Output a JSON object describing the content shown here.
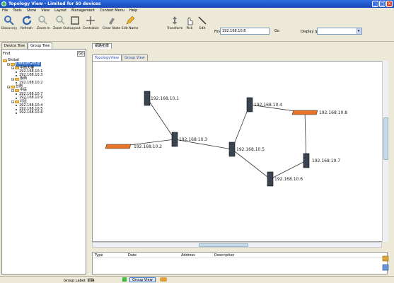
{
  "window": {
    "title": "Topology View - Limited for 50 devices"
  },
  "menu": [
    "File",
    "Tools",
    "Show",
    "View",
    "Layout",
    "Management",
    "Context Menu",
    "Help"
  ],
  "toolbar": {
    "buttons": [
      "Discovery",
      "Refresh",
      "Zoom In",
      "Zoom Out",
      "Layout",
      "Centralize",
      "Clear State",
      "Edit Name",
      "Transform",
      "Pick",
      "Edit"
    ],
    "find_label": "Find",
    "find_value": "192.168.10.8",
    "go_label": "Go",
    "display_label": "Display Ip"
  },
  "left": {
    "tabs": [
      "Device Tree",
      "Group Tree"
    ],
    "find_label": "Find",
    "find_button": "Go",
    "tree": [
      {
        "label": "Global",
        "level": 0,
        "type": "folder"
      },
      {
        "label": "DefaultGroup",
        "level": 1,
        "type": "folder",
        "selected": true
      },
      {
        "label": "中西大樓",
        "level": 2,
        "type": "folder"
      },
      {
        "label": "192.168.10.1",
        "level": 3,
        "type": "ip"
      },
      {
        "label": "192.168.10.3",
        "level": 3,
        "type": "ip"
      },
      {
        "label": "板西",
        "level": 2,
        "type": "folder"
      },
      {
        "label": "192.168.10.2",
        "level": 3,
        "type": "ip"
      },
      {
        "label": "台南",
        "level": 1,
        "type": "folder"
      },
      {
        "label": "中區",
        "level": 2,
        "type": "folder"
      },
      {
        "label": "192.168.10.7",
        "level": 3,
        "type": "ip"
      },
      {
        "label": "192.168.10.9",
        "level": 3,
        "type": "ip"
      },
      {
        "label": "北區",
        "level": 2,
        "type": "folder"
      },
      {
        "label": "192.168.10.4",
        "level": 3,
        "type": "ip"
      },
      {
        "label": "192.168.10.5",
        "level": 3,
        "type": "ip"
      },
      {
        "label": "192.168.10.6",
        "level": 3,
        "type": "ip"
      }
    ]
  },
  "right": {
    "doc_tab": "網路拓撲",
    "view_tabs": [
      "TopologyView",
      "Group View"
    ]
  },
  "topology": {
    "nodes": [
      {
        "label": "192.168.10.1",
        "kind": "tower"
      },
      {
        "label": "192.168.10.2",
        "kind": "flat"
      },
      {
        "label": "192.168.10.3",
        "kind": "tower"
      },
      {
        "label": "192.168.10.4",
        "kind": "tower"
      },
      {
        "label": "192.168.10.8",
        "kind": "flat"
      },
      {
        "label": "192.168.10.5",
        "kind": "tower"
      },
      {
        "label": "192.168.10.6",
        "kind": "tower"
      },
      {
        "label": "192.168.10.7",
        "kind": "tower"
      }
    ]
  },
  "log": {
    "columns": [
      "Type",
      "Date",
      "Address",
      "Description"
    ]
  },
  "status": {
    "text": "Group Label: 網路",
    "tab": "Group View"
  },
  "colors": {
    "titlebar": "#1f56c9",
    "selected": "#316ac5",
    "device_orange": "#e8742a"
  }
}
